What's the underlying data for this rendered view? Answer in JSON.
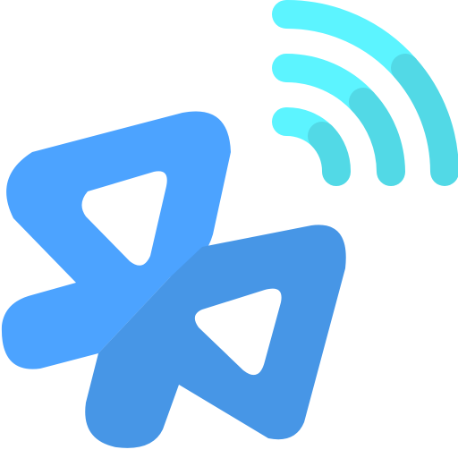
{
  "icon": {
    "name": "bluetooth-signal-icon",
    "colors": {
      "background": "#ffffff",
      "bluetooth_upper": "#4CA3FF",
      "bluetooth_lower": "#4796E6",
      "signal_light": "#5CF4FF",
      "signal_dark": "#52D9E6"
    }
  }
}
